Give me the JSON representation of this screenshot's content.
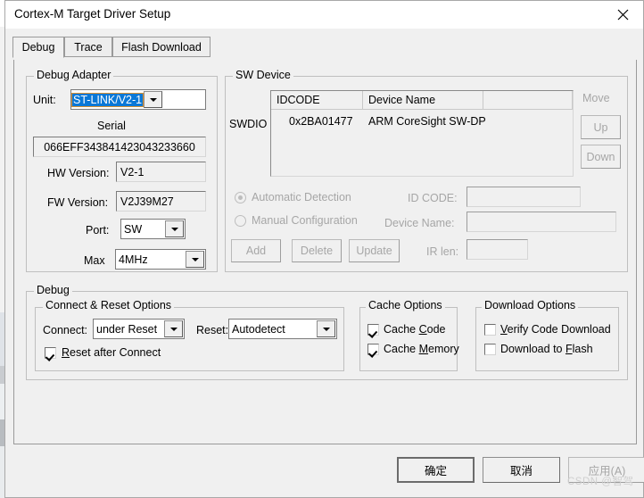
{
  "window": {
    "title": "Cortex-M Target Driver Setup",
    "close_icon": "close-icon"
  },
  "tabs": [
    {
      "label": "Debug",
      "selected": true
    },
    {
      "label": "Trace",
      "selected": false
    },
    {
      "label": "Flash Download",
      "selected": false
    }
  ],
  "debug_adapter": {
    "title": "Debug Adapter",
    "unit_label": "Unit:",
    "unit_value": "ST-LINK/V2-1",
    "serial_label": "Serial",
    "serial_value": "066EFF343841423043233660",
    "hw_version_label": "HW Version:",
    "hw_version_value": "V2-1",
    "fw_version_label": "FW Version:",
    "fw_version_value": "V2J39M27",
    "port_label": "Port:",
    "port_value": "SW",
    "max_label": "Max",
    "max_value": "4MHz"
  },
  "sw_device": {
    "title": "SW Device",
    "swdio_label": "SWDIO",
    "columns": [
      "IDCODE",
      "Device Name",
      ""
    ],
    "rows": [
      {
        "idcode": "0x2BA01477",
        "device_name": "ARM CoreSight SW-DP"
      }
    ],
    "move_label": "Move",
    "up_label": "Up",
    "down_label": "Down",
    "automatic_detection_label": "Automatic Detection",
    "manual_configuration_label": "Manual Configuration",
    "automatic_detection_checked": true,
    "manual_configuration_checked": false,
    "id_code_label": "ID CODE:",
    "id_code_value": "",
    "device_name_label": "Device Name:",
    "device_name_value": "",
    "ir_len_label": "IR len:",
    "ir_len_value": "",
    "add_label": "Add",
    "delete_label": "Delete",
    "update_label": "Update"
  },
  "debug_group": {
    "title": "Debug",
    "connect_reset": {
      "title": "Connect & Reset Options",
      "connect_label": "Connect:",
      "connect_value": "under Reset",
      "reset_label": "Reset:",
      "reset_value": "Autodetect",
      "reset_after_connect_label": "Reset after Connect",
      "reset_after_connect_accel": "R",
      "reset_after_connect_rest": "eset after Connect",
      "reset_after_connect_checked": true
    },
    "cache_options": {
      "title": "Cache Options",
      "cache_code_pre": "Cache ",
      "cache_code_accel": "C",
      "cache_code_post": "ode",
      "cache_code_checked": true,
      "cache_memory_pre": "Cache ",
      "cache_memory_accel": "M",
      "cache_memory_post": "emory",
      "cache_memory_checked": true
    },
    "download_options": {
      "title": "Download Options",
      "verify_pre": "",
      "verify_accel": "V",
      "verify_post": "erify Code Download",
      "verify_checked": false,
      "flash_pre": "Download to ",
      "flash_accel": "F",
      "flash_post": "lash",
      "flash_checked": false
    }
  },
  "footer": {
    "ok_label": "确定",
    "cancel_label": "取消",
    "apply_label": "应用(A)"
  },
  "watermark": {
    "text": "CSDN @智驾"
  },
  "colors": {
    "dialog_bg": "#f0f0f0",
    "selection_blue": "#0a78d7",
    "disabled_text": "#a6a6a6",
    "group_border": "#bfbfbf"
  }
}
